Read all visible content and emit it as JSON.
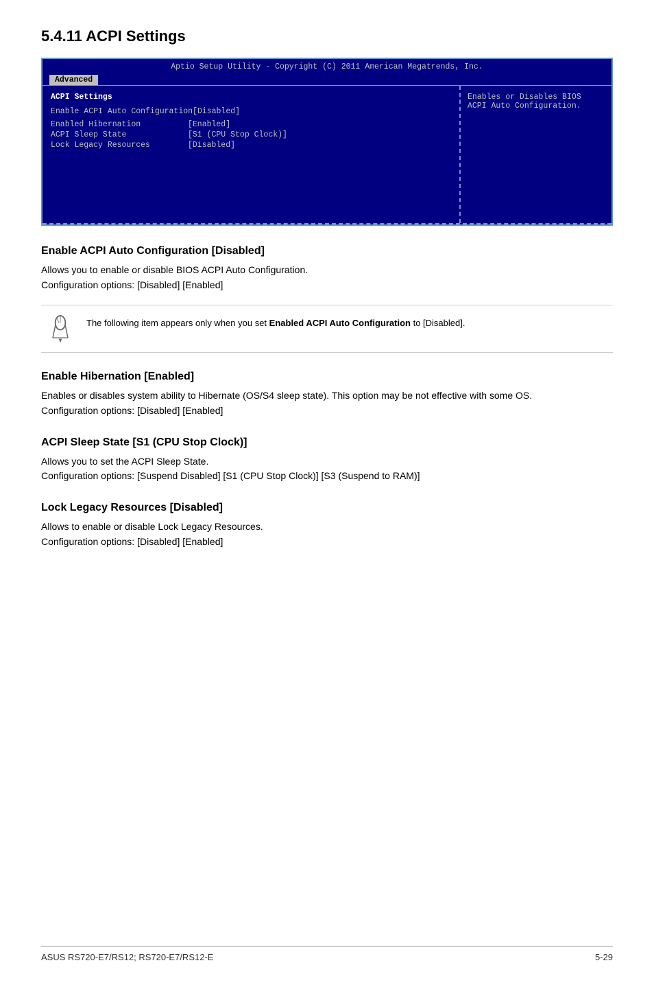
{
  "page": {
    "title": "5.4.11   ACPI Settings",
    "footer_left": "ASUS RS720-E7/RS12; RS720-E7/RS12-E",
    "footer_right": "5-29"
  },
  "bios": {
    "header": "Aptio Setup Utility - Copyright (C) 2011 American Megatrends, Inc.",
    "active_tab": "Advanced",
    "section_title": "ACPI Settings",
    "rows": [
      {
        "label": "Enable ACPI Auto Configuration",
        "value": "[Disabled]"
      }
    ],
    "group_rows": [
      {
        "label": "Enabled Hibernation",
        "value": "[Enabled]"
      },
      {
        "label": "ACPI Sleep State",
        "value": "[S1 (CPU Stop Clock)]"
      },
      {
        "label": "Lock Legacy Resources",
        "value": "[Disabled]"
      }
    ],
    "sidebar_text": "Enables or Disables BIOS ACPI Auto Configuration."
  },
  "sections": [
    {
      "id": "enable-acpi",
      "heading": "Enable ACPI Auto Configuration [Disabled]",
      "body": "Allows you to enable or disable BIOS ACPI Auto Configuration.\nConfiguration options: [Disabled] [Enabled]"
    },
    {
      "id": "enable-hibernation",
      "heading": "Enable Hibernation [Enabled]",
      "body": "Enables or disables system ability to Hibernate (OS/S4 sleep state). This option may be not effective with some OS.\nConfiguration options: [Disabled] [Enabled]"
    },
    {
      "id": "acpi-sleep-state",
      "heading": "ACPI Sleep State [S1 (CPU Stop Clock)]",
      "body": "Allows you to set the ACPI Sleep State.\nConfiguration options: [Suspend Disabled] [S1 (CPU Stop Clock)] [S3 (Suspend to RAM)]"
    },
    {
      "id": "lock-legacy",
      "heading": "Lock Legacy Resources [Disabled]",
      "body": "Allows to enable or disable Lock Legacy Resources.\nConfiguration options: [Disabled] [Enabled]"
    }
  ],
  "note": {
    "text_before": "The following item appears only when you set ",
    "bold_text": "Enabled ACPI Auto Configuration",
    "text_after": " to [Disabled]."
  }
}
